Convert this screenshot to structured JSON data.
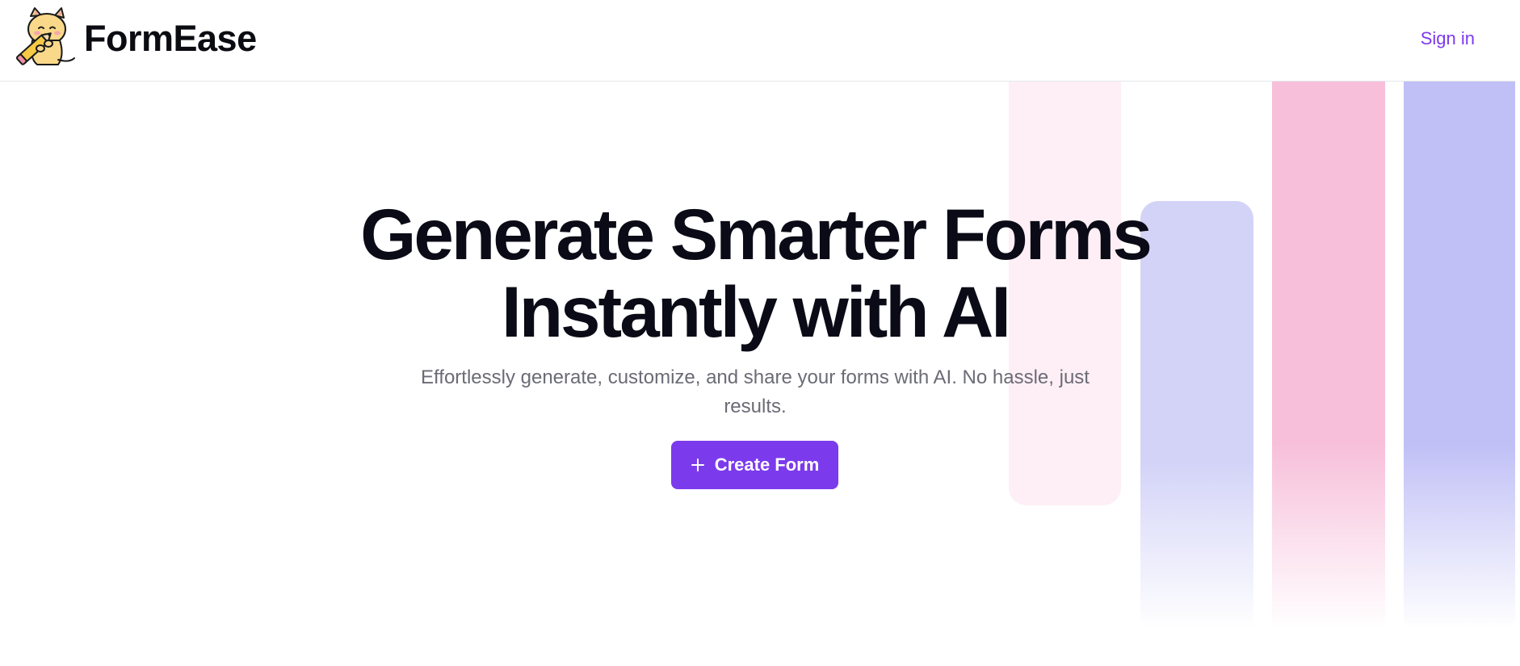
{
  "header": {
    "brand_name": "FormEase",
    "logo_icon": "cat-with-pencil-logo-icon",
    "sign_in_label": "Sign in"
  },
  "hero": {
    "title_line_1": "Generate Smarter Forms",
    "title_line_2": "Instantly with AI",
    "subtitle": "Effortlessly generate, customize, and share your forms with AI. No hassle, just results.",
    "cta_label": "Create Form",
    "cta_icon": "plus-icon"
  },
  "colors": {
    "accent": "#7c3aed",
    "title_text": "#0b0b17",
    "subtitle_text": "#6b6b76",
    "bar_light_pink": "#fdeff5",
    "bar_lavender": "#d3d3f8",
    "bar_pink": "#f7bfda",
    "bar_periwinkle": "#c0bff6"
  }
}
